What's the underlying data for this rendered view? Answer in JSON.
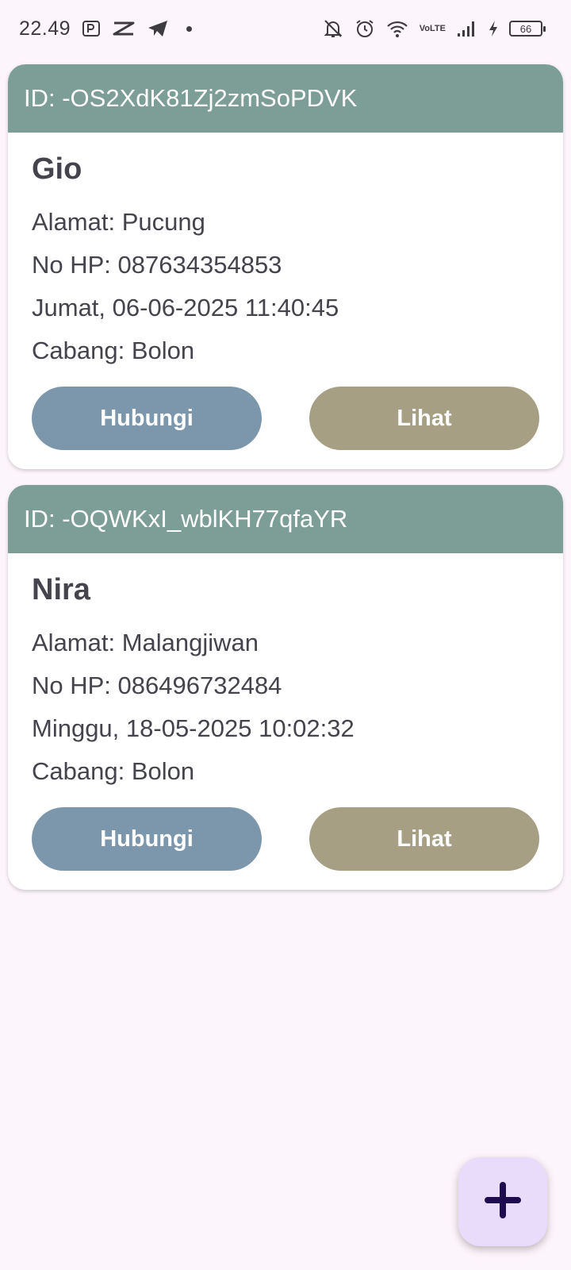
{
  "status_bar": {
    "time": "22.49",
    "lte_top": "Vo",
    "lte_bottom": "LTE",
    "battery": "66"
  },
  "records": [
    {
      "id_label": "ID: -OS2XdK81Zj2zmSoPDVK",
      "name": "Gio",
      "alamat": "Alamat: Pucung",
      "no_hp": "No HP: 087634354853",
      "datetime": "Jumat, 06-06-2025 11:40:45",
      "cabang": "Cabang: Bolon",
      "btn_contact": "Hubungi",
      "btn_view": "Lihat"
    },
    {
      "id_label": "ID: -OQWKxI_wblKH77qfaYR",
      "name": "Nira",
      "alamat": "Alamat: Malangjiwan",
      "no_hp": "No HP: 086496732484",
      "datetime": "Minggu, 18-05-2025 10:02:32",
      "cabang": "Cabang: Bolon",
      "btn_contact": "Hubungi",
      "btn_view": "Lihat"
    }
  ],
  "fab": {
    "icon": "plus-icon"
  },
  "colors": {
    "header": "#7c9e96",
    "hubungi": "#7c97ac",
    "lihat": "#a69f84",
    "fab": "#e8dcfa",
    "fab_icon": "#1f0b4f"
  }
}
